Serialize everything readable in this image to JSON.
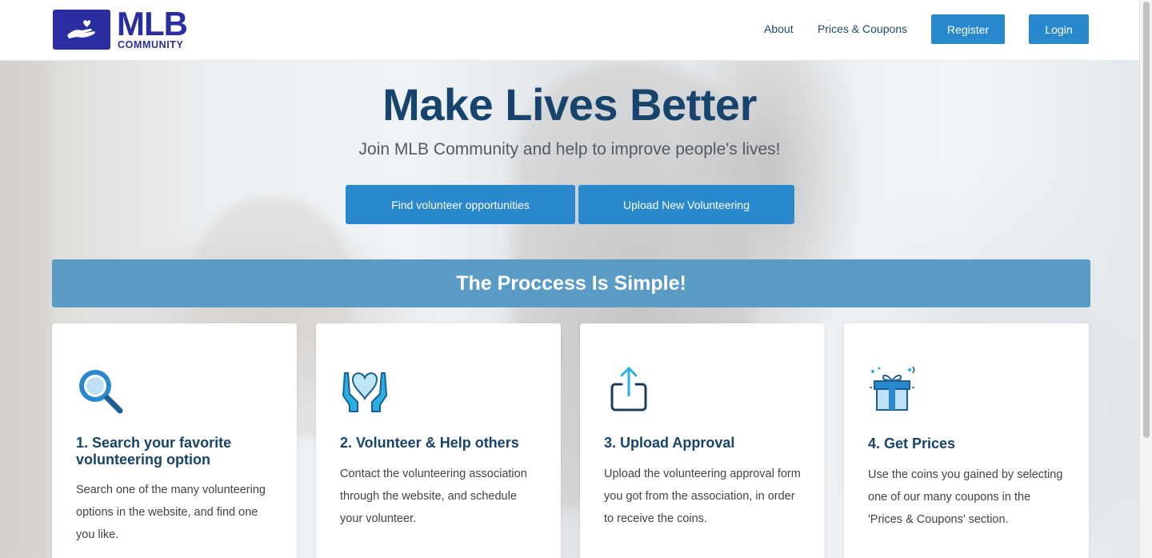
{
  "brand": {
    "logo_text": "MLB",
    "logo_subtext": "COMMUNITY",
    "color": "#2b2ea0"
  },
  "nav": {
    "about": "About",
    "prices_coupons": "Prices & Coupons",
    "register": "Register",
    "login": "Login"
  },
  "hero": {
    "title": "Make Lives Better",
    "subtitle": "Join MLB Community and help to improve people's lives!",
    "find_button": "Find volunteer opportunities",
    "upload_button": "Upload New Volunteering"
  },
  "process": {
    "banner": "The Proccess Is Simple!",
    "steps": [
      {
        "icon": "search-icon",
        "title": "1. Search your favorite volunteering option",
        "text": "Search one of the many volunteering options in the website, and find one you like."
      },
      {
        "icon": "heart-hands-icon",
        "title": "2. Volunteer & Help others",
        "text": "Contact the volunteering association through the website, and schedule your volunteer."
      },
      {
        "icon": "upload-icon",
        "title": "3. Upload Approval",
        "text": "Upload the volunteering approval form you got from the association, in order to receive the coins."
      },
      {
        "icon": "gift-icon",
        "title": "4. Get Prices",
        "text": "Use the coins you gained by selecting one of our many coupons in the 'Prices & Coupons' section."
      }
    ]
  },
  "colors": {
    "primary_button": "#2a88cc",
    "heading": "#17446c",
    "banner": "#5a9bc5"
  }
}
